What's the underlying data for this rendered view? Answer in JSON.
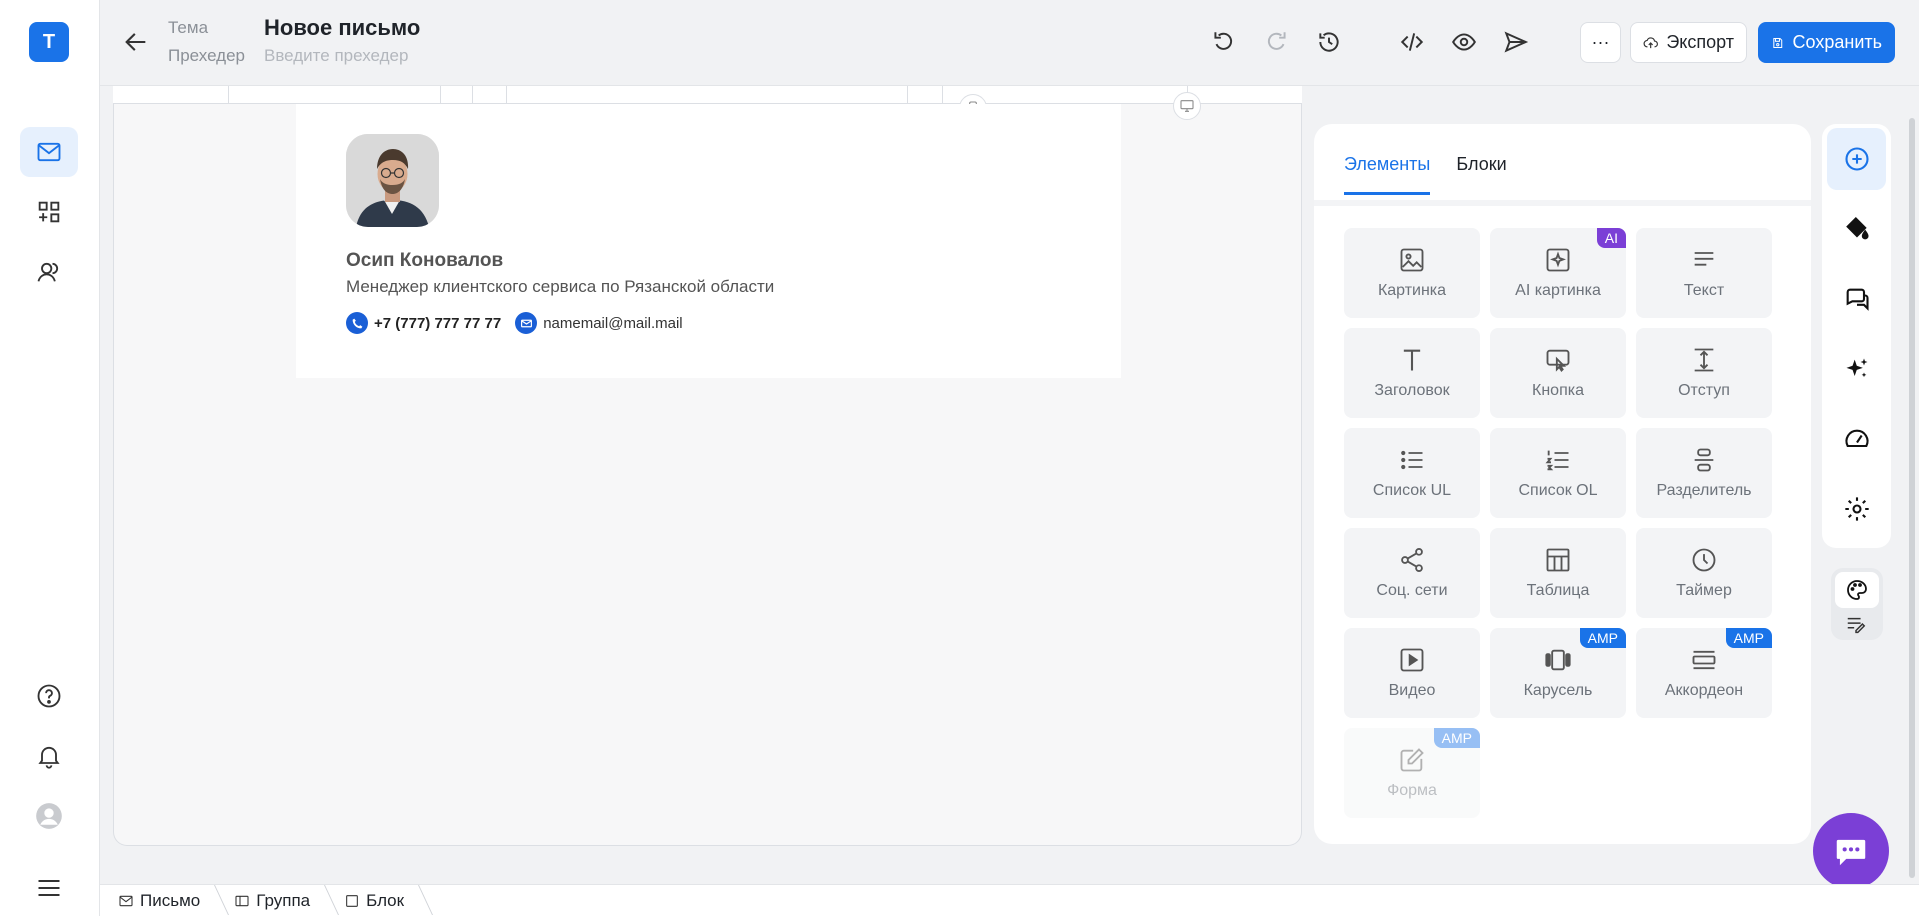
{
  "app": {
    "logo_letter": "T",
    "accent": "#1a73e8",
    "ai_color": "#7b3fd6"
  },
  "header": {
    "topic_label": "Тема",
    "title": "Новое письмо",
    "preheader_label": "Прехедер",
    "preheader_placeholder": "Введите прехедер",
    "more_label": "···",
    "export_label": "Экспорт",
    "save_label": "Сохранить"
  },
  "signature": {
    "name": "Осип Коновалов",
    "role": "Менеджер клиентского сервиса по Рязанской области",
    "phone": "+7 (777) 777 77 77",
    "email": "namemail@mail.mail"
  },
  "panel": {
    "tabs": [
      {
        "label": "Элементы",
        "active": true
      },
      {
        "label": "Блоки",
        "active": false
      }
    ],
    "elements": [
      {
        "label": "Картинка",
        "icon": "image-icon"
      },
      {
        "label": "AI картинка",
        "icon": "ai-image-icon",
        "badge": "AI"
      },
      {
        "label": "Текст",
        "icon": "text-icon"
      },
      {
        "label": "Заголовок",
        "icon": "heading-icon"
      },
      {
        "label": "Кнопка",
        "icon": "button-icon"
      },
      {
        "label": "Отступ",
        "icon": "spacer-icon"
      },
      {
        "label": "Список UL",
        "icon": "list-ul-icon"
      },
      {
        "label": "Список OL",
        "icon": "list-ol-icon"
      },
      {
        "label": "Разделитель",
        "icon": "divider-icon"
      },
      {
        "label": "Соц. сети",
        "icon": "share-icon"
      },
      {
        "label": "Таблица",
        "icon": "table-icon"
      },
      {
        "label": "Таймер",
        "icon": "timer-icon"
      },
      {
        "label": "Видео",
        "icon": "video-icon"
      },
      {
        "label": "Карусель",
        "icon": "carousel-icon",
        "badge": "AMP"
      },
      {
        "label": "Аккордеон",
        "icon": "accordion-icon",
        "badge": "AMP"
      },
      {
        "label": "Форма",
        "icon": "form-icon",
        "badge": "AMP",
        "disabled": true
      }
    ]
  },
  "footer": {
    "crumbs": [
      "Письмо",
      "Группа",
      "Блок"
    ]
  }
}
